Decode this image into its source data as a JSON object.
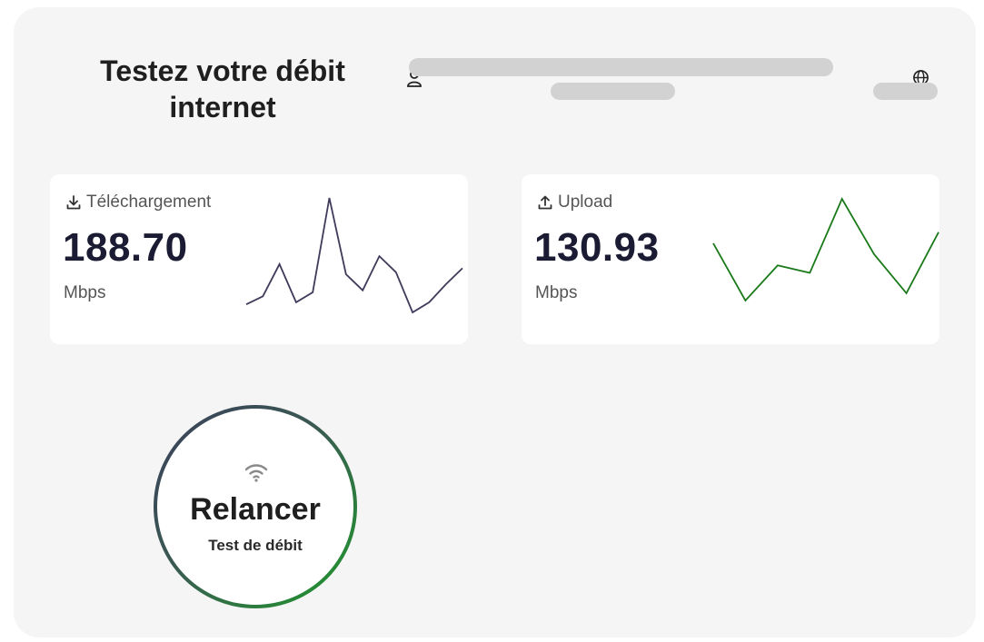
{
  "header": {
    "title": "Testez votre débit internet",
    "user_icon": "user-icon",
    "globe_icon": "globe-icon"
  },
  "download": {
    "label": "Téléchargement",
    "icon": "download-icon",
    "value": "188.70",
    "unit": "Mbps",
    "color": "#3f3b5a",
    "sparkline": [
      12,
      20,
      52,
      14,
      24,
      118,
      42,
      26,
      60,
      44,
      4,
      14,
      32,
      48
    ]
  },
  "upload": {
    "label": "Upload",
    "icon": "upload-icon",
    "value": "130.93",
    "unit": "Mbps",
    "color": "#1a7a1a",
    "sparkline": [
      62,
      0,
      38,
      30,
      110,
      50,
      8,
      74
    ]
  },
  "relaunch": {
    "label": "Relancer",
    "sublabel": "Test de débit",
    "icon": "wifi-icon",
    "gradient": [
      "#3b3f5c",
      "#1f9a2c"
    ]
  }
}
